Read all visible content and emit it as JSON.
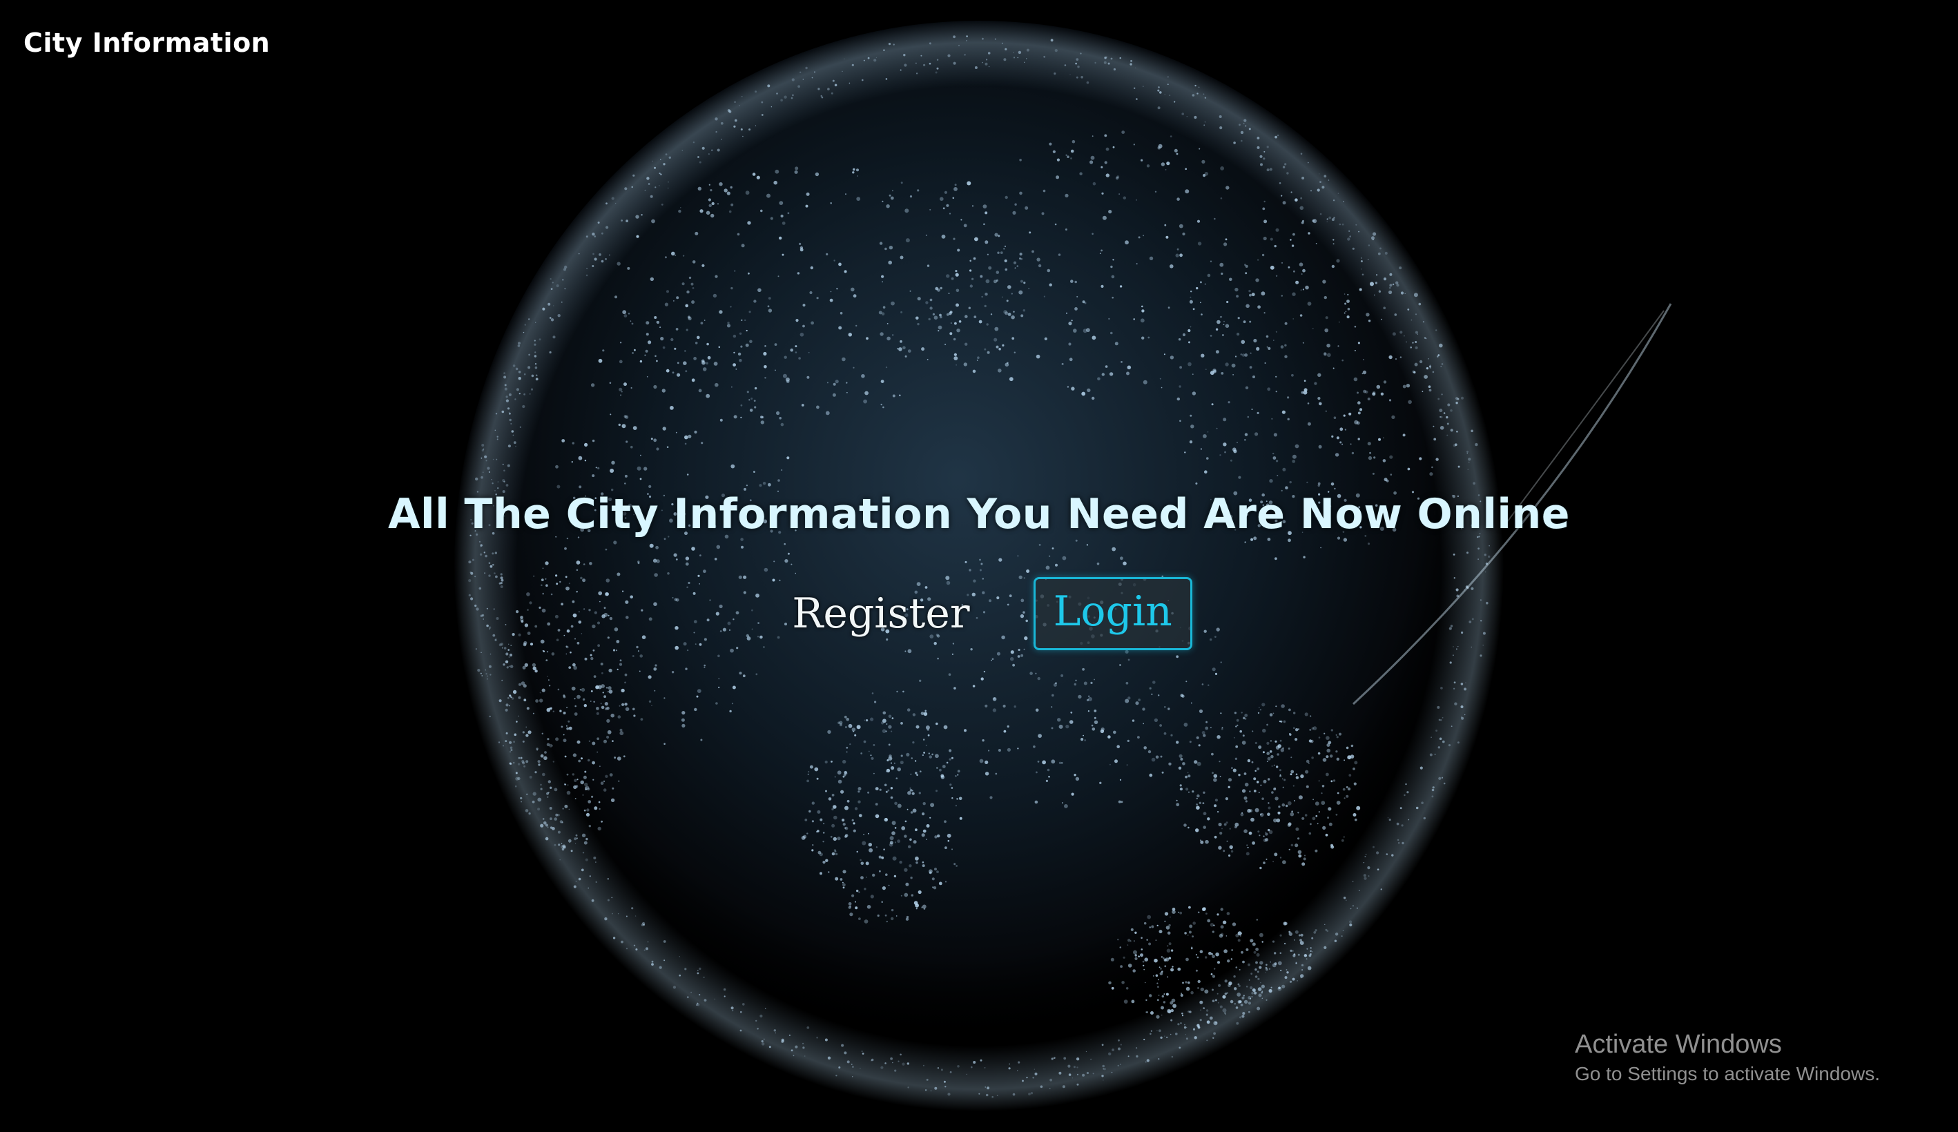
{
  "header": {
    "brand": "City Information"
  },
  "hero": {
    "headline": "All The City Information You Need Are Now Online",
    "register_label": "Register",
    "login_label": "Login",
    "background": "digital-dotted-earth-globe"
  },
  "os_watermark": {
    "title": "Activate Windows",
    "subtitle": "Go to Settings to activate Windows."
  },
  "colors": {
    "background": "#000000",
    "headline": "#d9f6ff",
    "login_accent": "#1ec8ea",
    "text": "#ffffff"
  }
}
